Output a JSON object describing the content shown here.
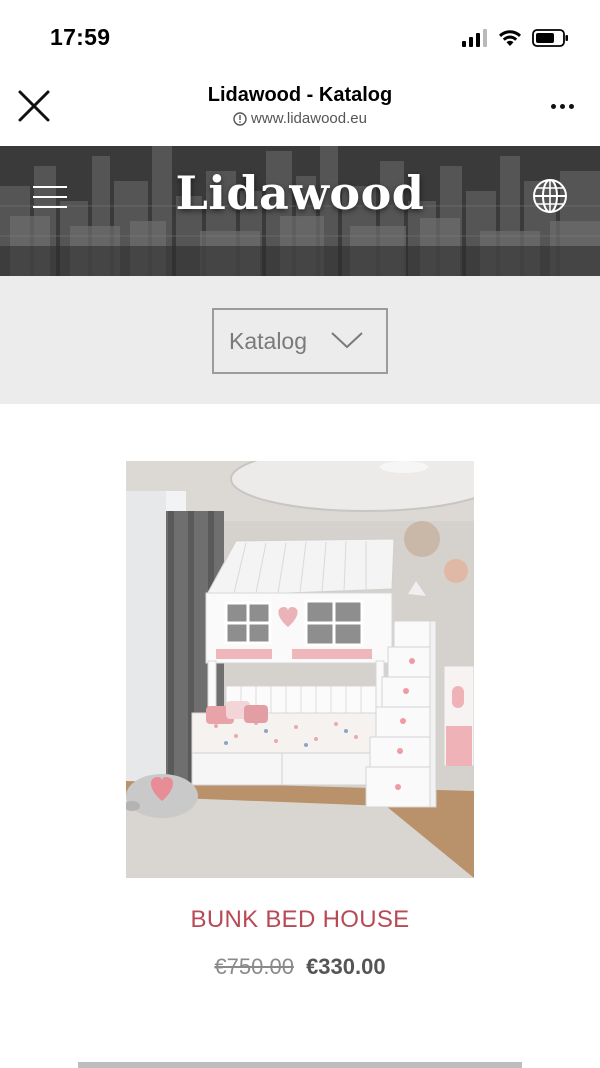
{
  "status_bar": {
    "time": "17:59",
    "icons": [
      "signal-icon",
      "wifi-icon",
      "battery-icon"
    ]
  },
  "browser": {
    "title": "Lidawood - Katalog",
    "url": "www.lidawood.eu",
    "close_icon": "close-icon",
    "more_icon": "more-icon"
  },
  "hero": {
    "logo": "Lidawood",
    "menu_icon": "hamburger-menu-icon",
    "language_icon": "globe-icon"
  },
  "catalog": {
    "label": "Katalog",
    "chevron_icon": "chevron-down-icon"
  },
  "product": {
    "name": "BUNK BED HOUSE",
    "old_price": "€750.00",
    "new_price": "€330.00"
  },
  "colors": {
    "accent": "#b84a55",
    "catalog_bg": "#ececec",
    "price_gray": "#555555"
  }
}
